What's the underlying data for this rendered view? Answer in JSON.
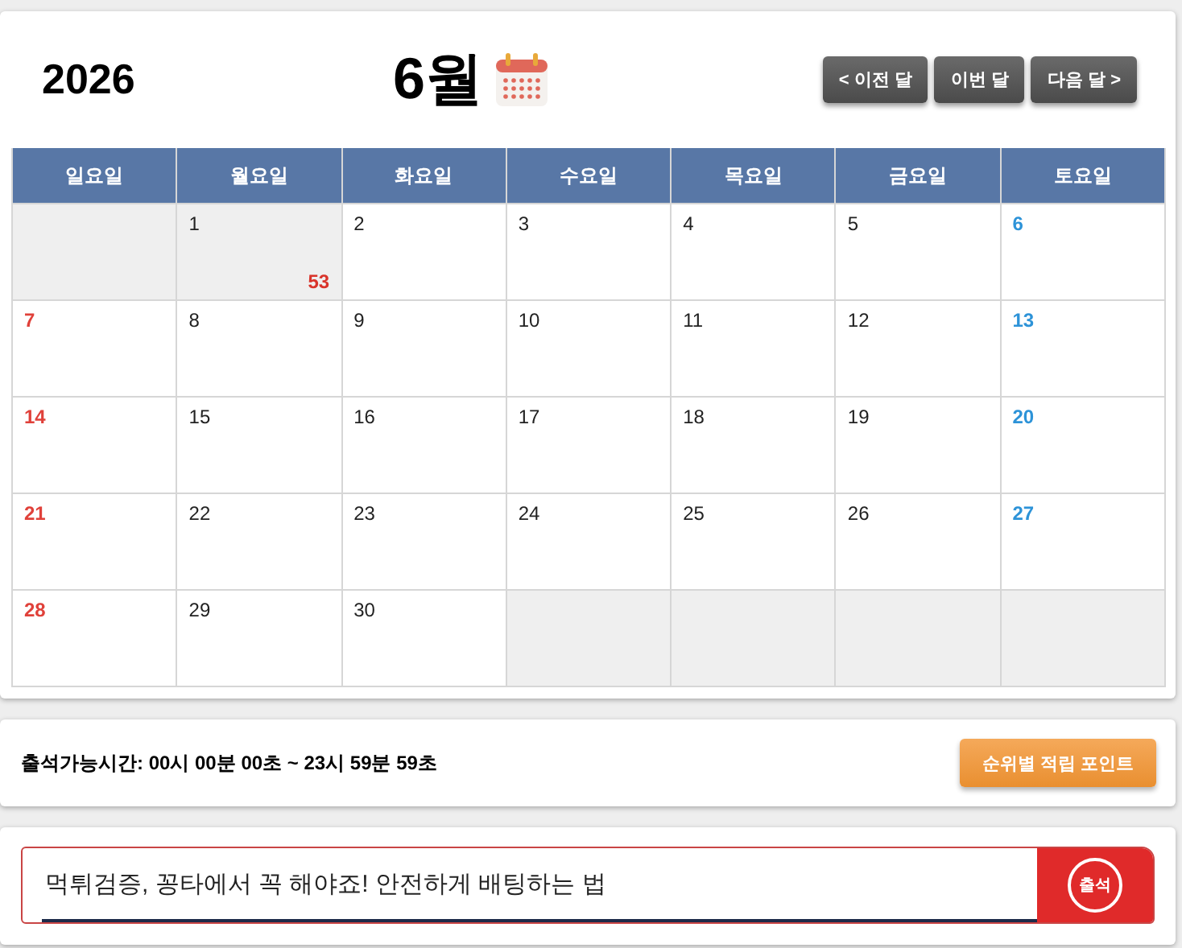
{
  "calendar": {
    "year": "2026",
    "month": "6월",
    "nav_buttons": [
      "< 이전 달",
      "이번 달",
      "다음 달 >"
    ],
    "weekdays": [
      "일요일",
      "월요일",
      "화요일",
      "수요일",
      "목요일",
      "금요일",
      "토요일"
    ],
    "weeks": [
      [
        {
          "kind": "empty"
        },
        {
          "kind": "day",
          "day": "1",
          "count": "53",
          "highlighted": true
        },
        {
          "kind": "day",
          "day": "2",
          "highlighted": false
        },
        {
          "kind": "day",
          "day": "3",
          "highlighted": false
        },
        {
          "kind": "day",
          "day": "4",
          "highlighted": false
        },
        {
          "kind": "day",
          "day": "5",
          "highlighted": false
        },
        {
          "kind": "day",
          "day": "6",
          "highlighted": false
        }
      ],
      [
        {
          "kind": "day",
          "day": "7",
          "highlighted": false
        },
        {
          "kind": "day",
          "day": "8",
          "highlighted": false
        },
        {
          "kind": "day",
          "day": "9",
          "highlighted": false
        },
        {
          "kind": "day",
          "day": "10",
          "highlighted": false
        },
        {
          "kind": "day",
          "day": "11",
          "highlighted": false
        },
        {
          "kind": "day",
          "day": "12",
          "highlighted": false
        },
        {
          "kind": "day",
          "day": "13",
          "highlighted": false
        }
      ],
      [
        {
          "kind": "day",
          "day": "14",
          "highlighted": false
        },
        {
          "kind": "day",
          "day": "15",
          "highlighted": false
        },
        {
          "kind": "day",
          "day": "16",
          "highlighted": false
        },
        {
          "kind": "day",
          "day": "17",
          "highlighted": false
        },
        {
          "kind": "day",
          "day": "18",
          "highlighted": false
        },
        {
          "kind": "day",
          "day": "19",
          "highlighted": false
        },
        {
          "kind": "day",
          "day": "20",
          "highlighted": false
        }
      ],
      [
        {
          "kind": "day",
          "day": "21",
          "highlighted": false
        },
        {
          "kind": "day",
          "day": "22",
          "highlighted": false
        },
        {
          "kind": "day",
          "day": "23",
          "highlighted": false
        },
        {
          "kind": "day",
          "day": "24",
          "highlighted": false
        },
        {
          "kind": "day",
          "day": "25",
          "highlighted": false
        },
        {
          "kind": "day",
          "day": "26",
          "highlighted": false
        },
        {
          "kind": "day",
          "day": "27",
          "highlighted": false
        }
      ],
      [
        {
          "kind": "day",
          "day": "28",
          "highlighted": false
        },
        {
          "kind": "day",
          "day": "29",
          "highlighted": false
        },
        {
          "kind": "day",
          "day": "30",
          "highlighted": false
        },
        {
          "kind": "empty"
        },
        {
          "kind": "empty"
        },
        {
          "kind": "empty"
        },
        {
          "kind": "empty"
        }
      ]
    ]
  },
  "attendance": {
    "hours": "출석가능시간: 00시 00분 00초 ~ 23시 59분 59초",
    "points_button": "순위별 적립 포인트"
  },
  "comment": {
    "value": "먹튀검증, 꽁타에서 꼭 해야죠! 안전하게 배팅하는 법",
    "stamp_button": "출석"
  }
}
